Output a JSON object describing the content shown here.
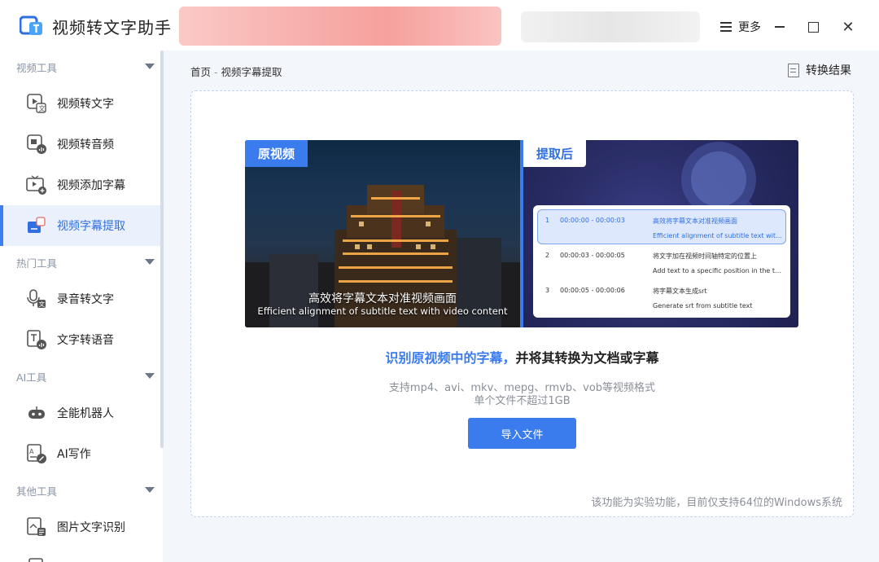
{
  "app": {
    "title": "视频转文字助手",
    "more_label": "更多",
    "close_glyph": "✕"
  },
  "sidebar": {
    "groups": [
      {
        "label": "视频工具",
        "items": [
          {
            "label": "视频转文字",
            "icon": "video-to-text-icon"
          },
          {
            "label": "视频转音频",
            "icon": "video-to-audio-icon"
          },
          {
            "label": "视频添加字幕",
            "icon": "video-add-subtitle-icon"
          },
          {
            "label": "视频字幕提取",
            "icon": "subtitle-extract-icon",
            "active": true
          }
        ]
      },
      {
        "label": "热门工具",
        "items": [
          {
            "label": "录音转文字",
            "icon": "microphone-icon"
          },
          {
            "label": "文字转语音",
            "icon": "text-to-speech-icon"
          }
        ]
      },
      {
        "label": "AI工具",
        "items": [
          {
            "label": "全能机器人",
            "icon": "robot-icon"
          },
          {
            "label": "AI写作",
            "icon": "ai-writing-icon"
          }
        ]
      },
      {
        "label": "其他工具",
        "items": [
          {
            "label": "图片文字识别",
            "icon": "image-ocr-icon"
          }
        ]
      }
    ]
  },
  "breadcrumb": {
    "home": "首页",
    "separator": "-",
    "current": "视频字幕提取"
  },
  "result_button": {
    "label": "转换结果"
  },
  "preview": {
    "original_tag": "原视频",
    "after_tag": "提取后",
    "subtitle_cn": "高效将字幕文本对准视频画面",
    "subtitle_en": "Efficient alignment of subtitle text with video content",
    "rows": [
      {
        "num": "1",
        "time": "00:00:00   -   00:00:03",
        "cn": "高效将字幕文本对准视频画面",
        "en": "Efficient alignment of subtitle text with video content",
        "highlight": true
      },
      {
        "num": "2",
        "time": "00:00:03   -   00:00:05",
        "cn": "将文字加在视频时间轴特定的位置上",
        "en": "Add text to a specific position in the timeline",
        "highlight": false
      },
      {
        "num": "3",
        "time": "00:00:05   -   00:00:06",
        "cn": "将字幕文本生成srt",
        "en": "Generate srt from subtitle text",
        "highlight": false
      }
    ]
  },
  "main": {
    "headline_blue": "识别原视频中的字幕，",
    "headline_rest": "并将其转换为文档或字幕",
    "support_text": "支持mp4、avi、mkv、mepg、rmvb、vob等视频格式",
    "limit_text": "单个文件不超过1GB",
    "import_label": "导入文件",
    "note": "该功能为实验功能，目前仅支持64位的Windows系统"
  },
  "colors": {
    "accent": "#3a7bed",
    "sidebar_active_bg": "#eaf1fd"
  }
}
